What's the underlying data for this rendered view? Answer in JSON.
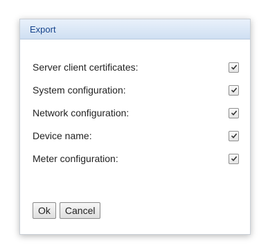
{
  "dialog": {
    "title": "Export",
    "options": [
      {
        "label": "Server client certificates:",
        "checked": true
      },
      {
        "label": "System configuration:",
        "checked": true
      },
      {
        "label": "Network configuration:",
        "checked": true
      },
      {
        "label": "Device name:",
        "checked": true
      },
      {
        "label": "Meter configuration:",
        "checked": true
      }
    ],
    "buttons": {
      "ok_label": "Ok",
      "cancel_label": "Cancel"
    }
  },
  "colors": {
    "header_text": "#15428b",
    "header_bg_top": "#e9f1fb",
    "header_bg_bottom": "#cfdff2",
    "check_mark": "#333333"
  },
  "icons": {
    "checkbox_check": "check-icon"
  }
}
